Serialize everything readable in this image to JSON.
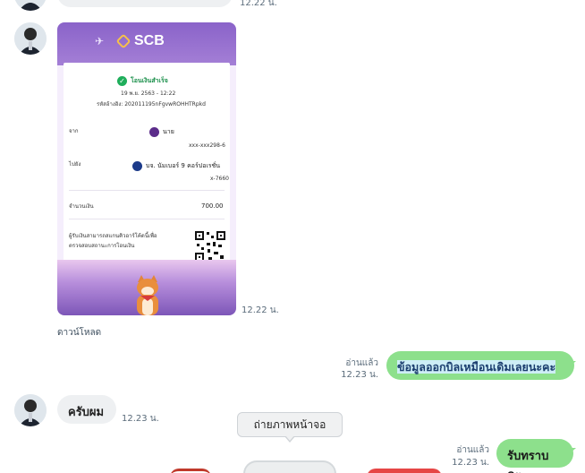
{
  "messages": {
    "top_time": "12.22 น.",
    "image_time": "12.22 น.",
    "download_label": "ดาวน์โหลด",
    "sent_1": {
      "read": "อ่านแล้ว",
      "time": "12.23 น.",
      "text": "ข้อมูลออกบิลเหมือนเดิมเลยนะคะ"
    },
    "received_1": {
      "text": "ครับผม",
      "time": "12.23 น."
    },
    "sent_2": {
      "read": "อ่านแล้ว",
      "time": "12.23 น.",
      "text": "รับทราบคะ"
    }
  },
  "receipt": {
    "brand": "SCB",
    "status": "โอนเงินสำเร็จ",
    "datetime": "19 พ.ย. 2563 - 12:22",
    "ref": "รหัสอ้างอิง: 202011195nFgvwROHHTRpkd",
    "from_label": "จาก",
    "from_name": "นาย",
    "from_account": "xxx-xxx298-6",
    "to_label": "ไปยัง",
    "to_name": "บจ. นัมเบอร์ 9 คอร์ปอเรชั่น",
    "to_account": "x-7660",
    "amount_label": "จำนวนเงิน",
    "amount": "700.00",
    "note_line1": "ผู้รับเงินสามารถสแกนคิวอาร์โค้ดนี้เพื่อ",
    "note_line2": "ตรวจสอบสถานะการโอนเงิน"
  },
  "tooltip": {
    "label": "ถ่ายภาพหน้าจอ"
  },
  "colors": {
    "sent_bubble": "#8de08c",
    "received_bubble": "#eef0f2",
    "scb_purple": "#8a63c9"
  }
}
